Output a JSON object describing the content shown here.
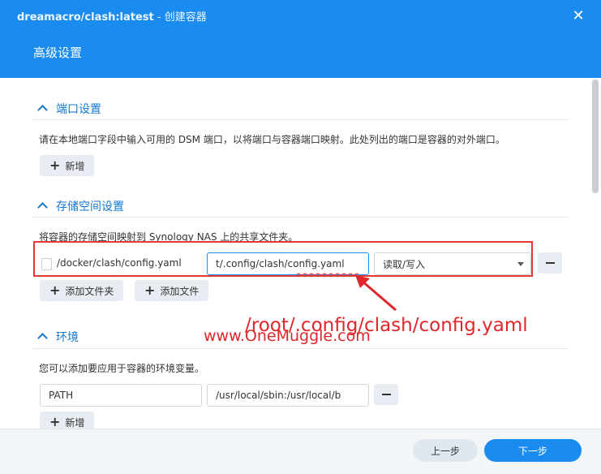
{
  "window": {
    "title_strong": "dreamacro/clash:latest",
    "title_suffix": " - 创建容器",
    "close_glyph": "✕"
  },
  "page_title": "高级设置",
  "ports": {
    "heading": "端口设置",
    "description": "请在本地端口字段中输入可用的 DSM 端口，以将端口与容器端口映射。此处列出的端口是容器的对外端口。",
    "add_label": "新增"
  },
  "storage": {
    "heading": "存储空间设置",
    "description": "将容器的存储空间映射到 Synology NAS 上的共享文件夹。",
    "row": {
      "host_path": "/docker/clash/config.yaml",
      "mount_path": "t/.config/clash/config.yaml",
      "permission": "读取/写入"
    },
    "add_folder_label": "添加文件夹",
    "add_file_label": "添加文件"
  },
  "annotation": {
    "text": "/root/.config/clash/config.yaml",
    "watermark": "www.OneMuggle.com",
    "color": "#e0262b"
  },
  "env": {
    "heading": "环境",
    "description": "您可以添加要应用于容器的环境变量。",
    "var_name": "PATH",
    "var_value": "/usr/local/sbin:/usr/local/b",
    "add_label": "新增"
  },
  "footer": {
    "prev_label": "上一步",
    "next_label": "下一步"
  },
  "colors": {
    "accent": "#1a8cf0",
    "header_bg": "#1a8cf0",
    "highlight": "#e53935"
  }
}
